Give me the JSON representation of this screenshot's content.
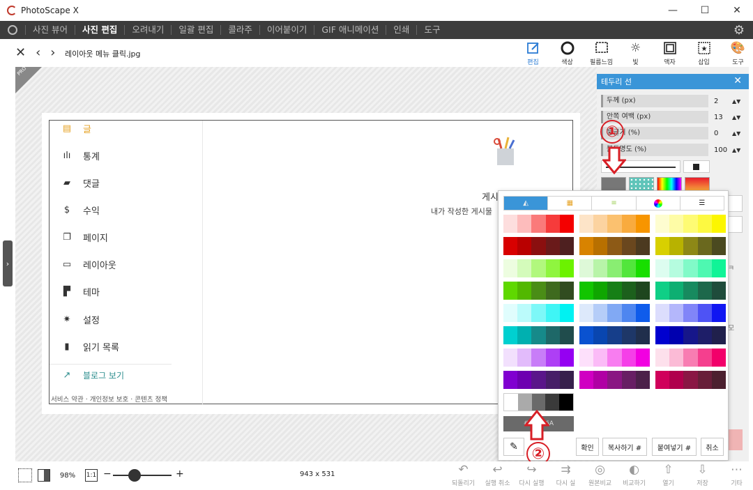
{
  "window": {
    "title": "PhotoScape X",
    "minimize": "—",
    "maximize": "☐",
    "close": "✕"
  },
  "menu": {
    "items": [
      "사진 뷰어",
      "사진 편집",
      "오려내기",
      "일괄 편집",
      "콜라주",
      "이어붙이기",
      "GIF 애니메이션",
      "인쇄",
      "도구"
    ],
    "active_index": 1
  },
  "toolbar": {
    "filename": "레이아웃 메뉴 클릭.jpg",
    "tools": [
      {
        "label": "편집",
        "icon": "edit-icon"
      },
      {
        "label": "색상",
        "icon": "color-circle-icon"
      },
      {
        "label": "필름느낌",
        "icon": "film-icon"
      },
      {
        "label": "빛",
        "icon": "sun-icon"
      },
      {
        "label": "액자",
        "icon": "frame-icon"
      },
      {
        "label": "삽입",
        "icon": "insert-star-icon"
      },
      {
        "label": "도구",
        "icon": "palette-icon"
      }
    ],
    "active_tool": "편집"
  },
  "canvas": {
    "pro_badge": "PRO",
    "side_menu": [
      "글",
      "통계",
      "댓글",
      "수익",
      "페이지",
      "레이아웃",
      "테마",
      "설정",
      "읽기 목록"
    ],
    "side_menu_icons": [
      "post-icon",
      "stats-icon",
      "comment-icon",
      "revenue-icon",
      "pages-icon",
      "layout-icon",
      "theme-icon",
      "settings-icon",
      "bookmark-icon"
    ],
    "blog_link": "블로그 보기",
    "footer_links": "서비스 약관 · 개인정보 보호 · 콘텐츠 정책",
    "empty_title": "게시",
    "empty_desc": "내가 작성한 게시물"
  },
  "panel": {
    "title": "테두리 선",
    "rows": [
      {
        "label": "두께 (px)",
        "value": "2"
      },
      {
        "label": "안쪽 여백 (px)",
        "value": "13"
      },
      {
        "label": "둥글기 (%)",
        "value": "0"
      },
      {
        "label": "불투명도 (%)",
        "value": "100"
      }
    ],
    "spin": "▲▼",
    "right_fragments": [
      "ㅋ",
      "모"
    ],
    "presets": [
      "#777777",
      "#5fc4b9",
      "rainbow",
      "red-gradient"
    ]
  },
  "popup": {
    "tabs": [
      "palette-icon",
      "swatch-icon",
      "gradient-icon",
      "hue-wheel-icon",
      "bars-icon"
    ],
    "active_tab": 0,
    "hex_value": "#6A6A6A",
    "buttons": {
      "ok": "확인",
      "copy": "복사하기 #",
      "paste": "붙여넣기 #",
      "cancel": "취소"
    }
  },
  "palette_rows": [
    [
      [
        "#fddede",
        "#fdbcbc",
        "#fa7a7a",
        "#f63b3b",
        "#f40000"
      ],
      [
        "#fde4c8",
        "#fcd3a0",
        "#fbc16f",
        "#f9ab3e",
        "#f79500"
      ],
      [
        "#fefdd0",
        "#fefca6",
        "#fefb74",
        "#fdf941",
        "#fcf600"
      ]
    ],
    [
      [
        "#d80000",
        "#b90000",
        "#8b0f0f",
        "#6a1a1a",
        "#4e2020"
      ],
      [
        "#d88300",
        "#b87000",
        "#8d5a16",
        "#6a471e",
        "#4c3a20"
      ],
      [
        "#d8d000",
        "#b8b200",
        "#8d8816",
        "#6a681e",
        "#4b4a20"
      ]
    ],
    [
      [
        "#edfde0",
        "#d4fbbb",
        "#b1f87d",
        "#8ff53f",
        "#6cf200"
      ],
      [
        "#def9d8",
        "#b8f4a8",
        "#89ee72",
        "#52e63c",
        "#18de00"
      ],
      [
        "#ddfdf0",
        "#b5fcdf",
        "#81fac8",
        "#4ef8b1",
        "#10f497"
      ]
    ],
    [
      [
        "#5fd800",
        "#52b800",
        "#4a8d16",
        "#3e6a1e",
        "#314c20"
      ],
      [
        "#12c500",
        "#0fa600",
        "#167f16",
        "#1c601c",
        "#1e461e"
      ],
      [
        "#0fcf86",
        "#0daf72",
        "#178a5f",
        "#1d684b",
        "#1f4c3b"
      ]
    ],
    [
      [
        "#e0fdfd",
        "#bbfbfb",
        "#7df8f8",
        "#3ff5f5",
        "#00f2f2"
      ],
      [
        "#dde9fb",
        "#b5cdf8",
        "#81a9f4",
        "#4e86f0",
        "#0f5ceb"
      ],
      [
        "#dcddfd",
        "#b4b7fb",
        "#8185f8",
        "#4e53f5",
        "#1016f2"
      ]
    ],
    [
      [
        "#00d0d0",
        "#00b0b0",
        "#168a8a",
        "#1e6868",
        "#204c4c"
      ],
      [
        "#0a52d0",
        "#0946b0",
        "#163e8a",
        "#1e3768",
        "#202f4c"
      ],
      [
        "#0000cf",
        "#0000af",
        "#16168a",
        "#1e1e68",
        "#20204c"
      ]
    ],
    [
      [
        "#f2e0fd",
        "#e2bbfb",
        "#c87df8",
        "#ae3ff5",
        "#9500f2"
      ],
      [
        "#fde0fb",
        "#fbbbf7",
        "#f87df0",
        "#f53fe8",
        "#f200e1"
      ],
      [
        "#fde0ec",
        "#fbbbd6",
        "#f87db2",
        "#f53f8e",
        "#f2006a"
      ]
    ],
    [
      [
        "#8000d0",
        "#6d00b0",
        "#5a168a",
        "#471e68",
        "#37204c"
      ],
      [
        "#d000c2",
        "#b000a4",
        "#8a1683",
        "#681e64",
        "#4c204a"
      ],
      [
        "#d0005b",
        "#b0004d",
        "#8a1644",
        "#681e39",
        "#4c202f"
      ]
    ]
  ],
  "grays": [
    "#ffffff",
    "#aaaaaa",
    "#6a6a6a",
    "#3a3a3a",
    "#000000"
  ],
  "annotations": {
    "step1": "①",
    "step2": "②"
  },
  "status": {
    "zoom": "98%",
    "one_to_one": "1:1",
    "zoom_level": 0.2,
    "minus": "−",
    "plus": "+",
    "size": "943 x 531",
    "actions": [
      {
        "label": "되돌리기",
        "icon": "revert-icon"
      },
      {
        "label": "실행 취소",
        "icon": "undo-icon"
      },
      {
        "label": "다시 실행",
        "icon": "redo-icon"
      },
      {
        "label": "다시 실",
        "icon": "redo-all-icon"
      },
      {
        "label": "원본비교",
        "icon": "compare-icon"
      },
      {
        "label": "비교하기",
        "icon": "compare2-icon"
      },
      {
        "label": "열기",
        "icon": "open-icon"
      },
      {
        "label": "저장",
        "icon": "save-icon"
      },
      {
        "label": "기타",
        "icon": "more-icon"
      }
    ]
  }
}
